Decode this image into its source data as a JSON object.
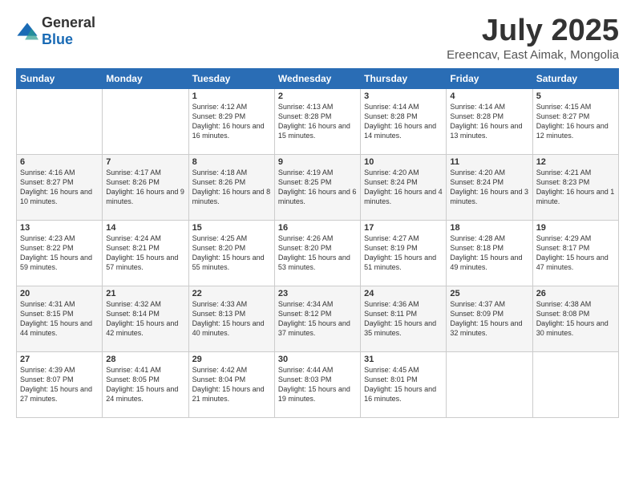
{
  "header": {
    "logo": {
      "general": "General",
      "blue": "Blue"
    },
    "title": "July 2025",
    "subtitle": "Ereencav, East Aimak, Mongolia"
  },
  "weekdays": [
    "Sunday",
    "Monday",
    "Tuesday",
    "Wednesday",
    "Thursday",
    "Friday",
    "Saturday"
  ],
  "weeks": [
    [
      {
        "day": "",
        "sunrise": "",
        "sunset": "",
        "daylight": ""
      },
      {
        "day": "",
        "sunrise": "",
        "sunset": "",
        "daylight": ""
      },
      {
        "day": "1",
        "sunrise": "Sunrise: 4:12 AM",
        "sunset": "Sunset: 8:29 PM",
        "daylight": "Daylight: 16 hours and 16 minutes."
      },
      {
        "day": "2",
        "sunrise": "Sunrise: 4:13 AM",
        "sunset": "Sunset: 8:28 PM",
        "daylight": "Daylight: 16 hours and 15 minutes."
      },
      {
        "day": "3",
        "sunrise": "Sunrise: 4:14 AM",
        "sunset": "Sunset: 8:28 PM",
        "daylight": "Daylight: 16 hours and 14 minutes."
      },
      {
        "day": "4",
        "sunrise": "Sunrise: 4:14 AM",
        "sunset": "Sunset: 8:28 PM",
        "daylight": "Daylight: 16 hours and 13 minutes."
      },
      {
        "day": "5",
        "sunrise": "Sunrise: 4:15 AM",
        "sunset": "Sunset: 8:27 PM",
        "daylight": "Daylight: 16 hours and 12 minutes."
      }
    ],
    [
      {
        "day": "6",
        "sunrise": "Sunrise: 4:16 AM",
        "sunset": "Sunset: 8:27 PM",
        "daylight": "Daylight: 16 hours and 10 minutes."
      },
      {
        "day": "7",
        "sunrise": "Sunrise: 4:17 AM",
        "sunset": "Sunset: 8:26 PM",
        "daylight": "Daylight: 16 hours and 9 minutes."
      },
      {
        "day": "8",
        "sunrise": "Sunrise: 4:18 AM",
        "sunset": "Sunset: 8:26 PM",
        "daylight": "Daylight: 16 hours and 8 minutes."
      },
      {
        "day": "9",
        "sunrise": "Sunrise: 4:19 AM",
        "sunset": "Sunset: 8:25 PM",
        "daylight": "Daylight: 16 hours and 6 minutes."
      },
      {
        "day": "10",
        "sunrise": "Sunrise: 4:20 AM",
        "sunset": "Sunset: 8:24 PM",
        "daylight": "Daylight: 16 hours and 4 minutes."
      },
      {
        "day": "11",
        "sunrise": "Sunrise: 4:20 AM",
        "sunset": "Sunset: 8:24 PM",
        "daylight": "Daylight: 16 hours and 3 minutes."
      },
      {
        "day": "12",
        "sunrise": "Sunrise: 4:21 AM",
        "sunset": "Sunset: 8:23 PM",
        "daylight": "Daylight: 16 hours and 1 minute."
      }
    ],
    [
      {
        "day": "13",
        "sunrise": "Sunrise: 4:23 AM",
        "sunset": "Sunset: 8:22 PM",
        "daylight": "Daylight: 15 hours and 59 minutes."
      },
      {
        "day": "14",
        "sunrise": "Sunrise: 4:24 AM",
        "sunset": "Sunset: 8:21 PM",
        "daylight": "Daylight: 15 hours and 57 minutes."
      },
      {
        "day": "15",
        "sunrise": "Sunrise: 4:25 AM",
        "sunset": "Sunset: 8:20 PM",
        "daylight": "Daylight: 15 hours and 55 minutes."
      },
      {
        "day": "16",
        "sunrise": "Sunrise: 4:26 AM",
        "sunset": "Sunset: 8:20 PM",
        "daylight": "Daylight: 15 hours and 53 minutes."
      },
      {
        "day": "17",
        "sunrise": "Sunrise: 4:27 AM",
        "sunset": "Sunset: 8:19 PM",
        "daylight": "Daylight: 15 hours and 51 minutes."
      },
      {
        "day": "18",
        "sunrise": "Sunrise: 4:28 AM",
        "sunset": "Sunset: 8:18 PM",
        "daylight": "Daylight: 15 hours and 49 minutes."
      },
      {
        "day": "19",
        "sunrise": "Sunrise: 4:29 AM",
        "sunset": "Sunset: 8:17 PM",
        "daylight": "Daylight: 15 hours and 47 minutes."
      }
    ],
    [
      {
        "day": "20",
        "sunrise": "Sunrise: 4:31 AM",
        "sunset": "Sunset: 8:15 PM",
        "daylight": "Daylight: 15 hours and 44 minutes."
      },
      {
        "day": "21",
        "sunrise": "Sunrise: 4:32 AM",
        "sunset": "Sunset: 8:14 PM",
        "daylight": "Daylight: 15 hours and 42 minutes."
      },
      {
        "day": "22",
        "sunrise": "Sunrise: 4:33 AM",
        "sunset": "Sunset: 8:13 PM",
        "daylight": "Daylight: 15 hours and 40 minutes."
      },
      {
        "day": "23",
        "sunrise": "Sunrise: 4:34 AM",
        "sunset": "Sunset: 8:12 PM",
        "daylight": "Daylight: 15 hours and 37 minutes."
      },
      {
        "day": "24",
        "sunrise": "Sunrise: 4:36 AM",
        "sunset": "Sunset: 8:11 PM",
        "daylight": "Daylight: 15 hours and 35 minutes."
      },
      {
        "day": "25",
        "sunrise": "Sunrise: 4:37 AM",
        "sunset": "Sunset: 8:09 PM",
        "daylight": "Daylight: 15 hours and 32 minutes."
      },
      {
        "day": "26",
        "sunrise": "Sunrise: 4:38 AM",
        "sunset": "Sunset: 8:08 PM",
        "daylight": "Daylight: 15 hours and 30 minutes."
      }
    ],
    [
      {
        "day": "27",
        "sunrise": "Sunrise: 4:39 AM",
        "sunset": "Sunset: 8:07 PM",
        "daylight": "Daylight: 15 hours and 27 minutes."
      },
      {
        "day": "28",
        "sunrise": "Sunrise: 4:41 AM",
        "sunset": "Sunset: 8:05 PM",
        "daylight": "Daylight: 15 hours and 24 minutes."
      },
      {
        "day": "29",
        "sunrise": "Sunrise: 4:42 AM",
        "sunset": "Sunset: 8:04 PM",
        "daylight": "Daylight: 15 hours and 21 minutes."
      },
      {
        "day": "30",
        "sunrise": "Sunrise: 4:44 AM",
        "sunset": "Sunset: 8:03 PM",
        "daylight": "Daylight: 15 hours and 19 minutes."
      },
      {
        "day": "31",
        "sunrise": "Sunrise: 4:45 AM",
        "sunset": "Sunset: 8:01 PM",
        "daylight": "Daylight: 15 hours and 16 minutes."
      },
      {
        "day": "",
        "sunrise": "",
        "sunset": "",
        "daylight": ""
      },
      {
        "day": "",
        "sunrise": "",
        "sunset": "",
        "daylight": ""
      }
    ]
  ]
}
